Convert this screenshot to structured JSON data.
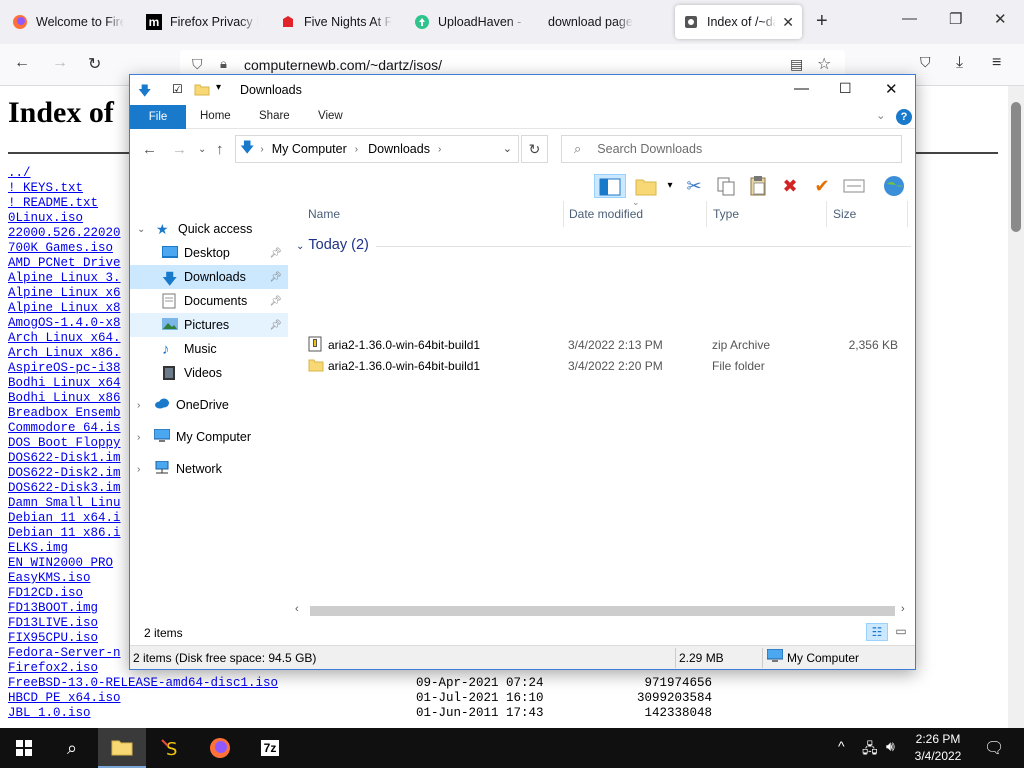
{
  "browser": {
    "tabs": [
      {
        "title": "Welcome to Fire",
        "icon": "firefox-icon"
      },
      {
        "title": "Firefox Privacy N",
        "icon": "mozilla-m-icon"
      },
      {
        "title": "Five Nights At Fr",
        "icon": "red-icon"
      },
      {
        "title": "UploadHaven - F",
        "icon": "uploadhaven-icon"
      },
      {
        "title": "download page",
        "icon": ""
      },
      {
        "title": "Index of /~dar",
        "icon": "page-icon"
      }
    ],
    "url": "computernewb.com/~dartz/isos/"
  },
  "page": {
    "heading": "Index of",
    "links": [
      "../",
      "! KEYS.txt",
      "! README.txt",
      "0Linux.iso",
      "22000.526.22020",
      "700K Games.iso",
      "AMD PCNet Drive",
      "Alpine Linux 3.",
      "Alpine Linux x6",
      "Alpine Linux x8",
      "AmogOS-1.4.0-x8",
      "Arch Linux x64.",
      "Arch Linux x86.",
      "AspireOS-pc-i38",
      "Bodhi Linux x64",
      "Bodhi Linux x86",
      "Breadbox Ensemb",
      "Commodore 64.is",
      "DOS Boot Floppy",
      "DOS622-Disk1.im",
      "DOS622-Disk2.im",
      "DOS622-Disk3.im",
      "Damn Small Linu",
      "Debian 11 x64.i",
      "Debian 11 x86.i",
      "ELKS.img",
      "EN WIN2000 PRO",
      "EasyKMS.iso",
      "FD12CD.iso",
      "FD13BOOT.img",
      "FD13LIVE.iso",
      "FIX95CPU.iso",
      "Fedora-Server-n",
      "Firefox2.iso",
      "FreeBSD-13.0-RELEASE-amd64-disc1.iso",
      "HBCD PE x64.iso",
      "JBL 1.0.iso"
    ],
    "rows_meta": [
      {
        "date": "09-Apr-2021 07:24",
        "size": "971974656"
      },
      {
        "date": "01-Jul-2021 16:10",
        "size": "3099203584"
      },
      {
        "date": "01-Jun-2011 17:43",
        "size": "142338048"
      }
    ]
  },
  "explorer": {
    "title": "Downloads",
    "ribbon_tabs": [
      "File",
      "Home",
      "Share",
      "View"
    ],
    "address": [
      "My Computer",
      "Downloads"
    ],
    "search_placeholder": "Search Downloads",
    "nav": {
      "quick_access": "Quick access",
      "desktop": "Desktop",
      "downloads": "Downloads",
      "documents": "Documents",
      "pictures": "Pictures",
      "music": "Music",
      "videos": "Videos",
      "onedrive": "OneDrive",
      "my_computer": "My Computer",
      "network": "Network"
    },
    "columns": [
      "Name",
      "Date modified",
      "Type",
      "Size"
    ],
    "group": "Today (2)",
    "files": [
      {
        "name": "aria2-1.36.0-win-64bit-build1",
        "date": "3/4/2022 2:13 PM",
        "type": "zip Archive",
        "size": "2,356 KB"
      },
      {
        "name": "aria2-1.36.0-win-64bit-build1",
        "date": "3/4/2022 2:20 PM",
        "type": "File folder",
        "size": ""
      }
    ],
    "item_count": "2 items",
    "status_detail": "2 items (Disk free space: 94.5 GB)",
    "status_size": "2.29 MB",
    "status_location": "My Computer"
  },
  "taskbar": {
    "time": "2:26 PM",
    "date": "3/4/2022"
  },
  "colors": {
    "accent": "#1979ca",
    "selection": "#cce8ff",
    "link": "#0000ee"
  }
}
